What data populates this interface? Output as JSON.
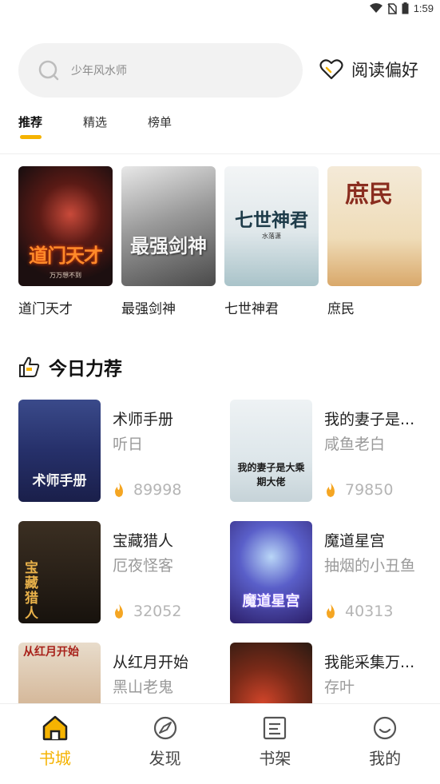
{
  "status_bar": {
    "time": "1:59"
  },
  "search": {
    "placeholder": "少年风水师"
  },
  "preference": {
    "label": "阅读偏好"
  },
  "tabs": [
    {
      "label": "推荐",
      "active": true
    },
    {
      "label": "精选",
      "active": false
    },
    {
      "label": "榜单",
      "active": false
    }
  ],
  "featured": [
    {
      "title": "道门天才",
      "cover_text": "道门天才",
      "cover_author": "万万想不到"
    },
    {
      "title": "最强剑神",
      "cover_text": "最强剑神",
      "cover_author": ""
    },
    {
      "title": "七世神君",
      "cover_text": "七世神君",
      "cover_author": "水落潇"
    },
    {
      "title": "庶民",
      "cover_text": "庶民",
      "cover_author": ""
    }
  ],
  "section": {
    "title": "今日力荐"
  },
  "recommend": [
    {
      "title": "术师手册",
      "author": "听日",
      "heat": "89998",
      "cover_text": "术师手册"
    },
    {
      "title": "我的妻子是...",
      "author": "咸鱼老白",
      "heat": "79850",
      "cover_text": "我的妻子是大乘期大佬"
    },
    {
      "title": "宝藏猎人",
      "author": "厄夜怪客",
      "heat": "32052",
      "cover_text": "宝藏猎人"
    },
    {
      "title": "魔道星宫",
      "author": "抽烟的小丑鱼",
      "heat": "40313",
      "cover_text": "魔道星宫"
    },
    {
      "title": "从红月开始",
      "author": "黑山老鬼",
      "heat": "",
      "cover_text": "从红月开始"
    },
    {
      "title": "我能采集万...",
      "author": "存叶",
      "heat": "",
      "cover_text": ""
    }
  ],
  "nav": [
    {
      "label": "书城",
      "icon": "home-icon",
      "active": true
    },
    {
      "label": "发现",
      "icon": "discover-icon",
      "active": false
    },
    {
      "label": "书架",
      "icon": "bookshelf-icon",
      "active": false
    },
    {
      "label": "我的",
      "icon": "profile-icon",
      "active": false
    }
  ],
  "colors": {
    "accent": "#f5b301",
    "flame": "#f5a623",
    "muted": "#9a9a9a"
  }
}
